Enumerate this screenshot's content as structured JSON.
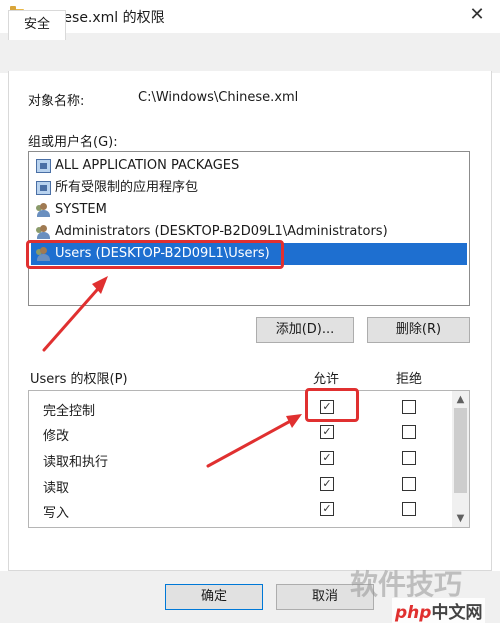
{
  "window": {
    "title": "Chinese.xml 的权限",
    "close_glyph": "✕"
  },
  "tabs": [
    {
      "label": "安全"
    }
  ],
  "object": {
    "label": "对象名称:",
    "value": "C:\\Windows\\Chinese.xml"
  },
  "groups": {
    "label": "组或用户名(G):",
    "items": [
      {
        "label": "ALL APPLICATION PACKAGES",
        "icon": "package-icon"
      },
      {
        "label": "所有受限制的应用程序包",
        "icon": "package-icon"
      },
      {
        "label": "SYSTEM",
        "icon": "users-icon"
      },
      {
        "label": "Administrators (DESKTOP-B2D09L1\\Administrators)",
        "icon": "users-icon"
      },
      {
        "label": "Users (DESKTOP-B2D09L1\\Users)",
        "icon": "users-icon",
        "selected": true
      }
    ],
    "add_button": "添加(D)...",
    "remove_button": "删除(R)"
  },
  "permissions": {
    "label": "Users 的权限(P)",
    "allow_header": "允许",
    "deny_header": "拒绝",
    "rows": [
      {
        "name": "完全控制",
        "allow": true,
        "deny": false
      },
      {
        "name": "修改",
        "allow": true,
        "deny": false
      },
      {
        "name": "读取和执行",
        "allow": true,
        "deny": false
      },
      {
        "name": "读取",
        "allow": true,
        "deny": false
      },
      {
        "name": "写入",
        "allow": true,
        "deny": false
      }
    ],
    "check_glyph": "✓"
  },
  "footer": {
    "ok_button": "确定",
    "cancel_button": "取消"
  },
  "watermark": {
    "text": "软件技巧",
    "logo_php": "php",
    "logo_site": "中文网"
  },
  "colors": {
    "selection": "#1e6fd0",
    "highlight": "#e03030"
  }
}
